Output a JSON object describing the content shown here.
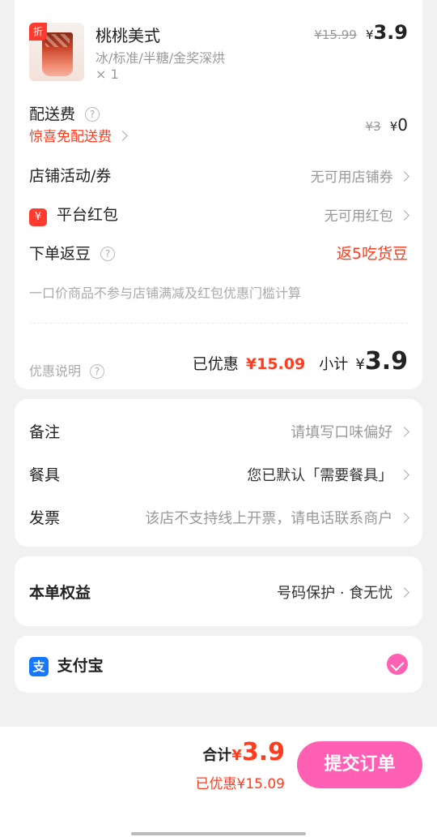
{
  "product": {
    "badge": "折",
    "name": "桃桃美式",
    "options": "冰/标准/半糖/金奖深烘",
    "quantity": "× 1",
    "original_price": "¥15.99",
    "currency": "¥",
    "price": "3.9"
  },
  "delivery": {
    "label": "配送费",
    "help_icon": "question-icon",
    "promo": "惊喜免配送费",
    "original_fee": "¥3",
    "currency": "¥",
    "fee": "0"
  },
  "store_promo": {
    "label": "店铺活动/券",
    "value": "无可用店铺券"
  },
  "platform_redpacket": {
    "icon": "¥",
    "label": "平台红包",
    "value": "无可用红包"
  },
  "cashback": {
    "label": "下单返豆",
    "value": "返5吃货豆"
  },
  "note_text": "一口价商品不参与店铺满减及红包优惠门槛计算",
  "summary": {
    "discount_desc_label": "优惠说明",
    "discount_label": "已优惠",
    "discount_value": "¥15.09",
    "subtotal_label": "小计",
    "currency": "¥",
    "subtotal_value": "3.9"
  },
  "extras": [
    {
      "label": "备注",
      "value": "请填写口味偏好"
    },
    {
      "label": "餐具",
      "value": "您已默认「需要餐具」"
    },
    {
      "label": "发票",
      "value": "该店不支持线上开票，请电话联系商户"
    }
  ],
  "benefits": {
    "label": "本单权益",
    "value": "号码保护 · 食无忧"
  },
  "payment": {
    "icon": "支",
    "method": "支付宝",
    "selected": true
  },
  "footer": {
    "total_label": "合计",
    "currency": "¥",
    "total_value": "3.9",
    "discount_text": "已优惠¥15.09",
    "submit_label": "提交订单"
  },
  "colors": {
    "accent_red": "#ff3d1e",
    "submit_pink": "#ff60b4",
    "alipay_blue": "#1677ff"
  }
}
